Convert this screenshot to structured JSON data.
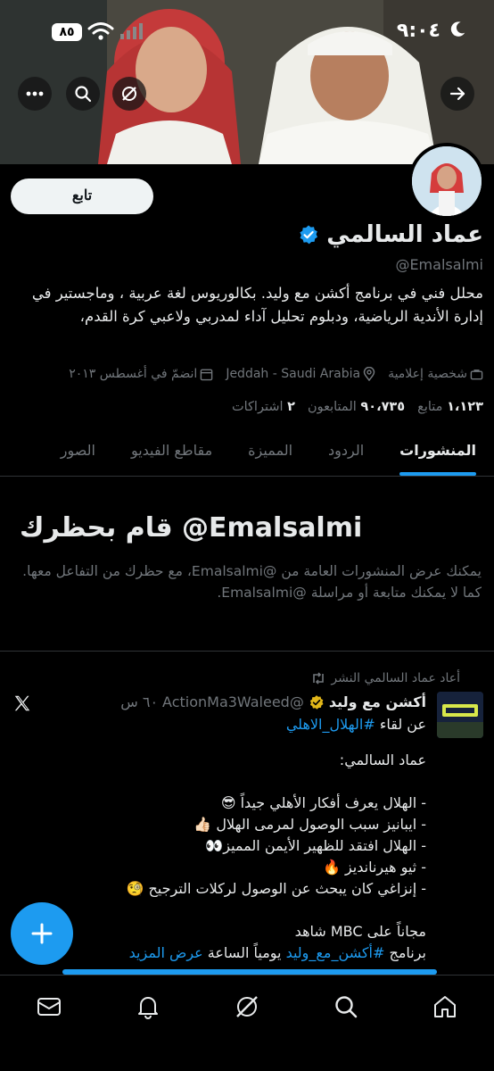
{
  "status_bar": {
    "time": "٩:٠٤",
    "battery": "٨٥"
  },
  "profile": {
    "follow_label": "تابع",
    "name": "عماد السالمي",
    "handle": "@Emalsalmi",
    "bio": "محلل فني في برنامج أكشن مع وليد. بكالوريوس لغة عربية ، وماجستير في إدارة الأندية الرياضية، ودبلوم تحليل آداء لمدربي ولاعبي كرة القدم،",
    "category": "شخصية إعلامية",
    "location": "Jeddah - Saudi Arabia",
    "joined": "انضمّ في أغسطس ٢٠١٣",
    "following_count": "١،١٢٣",
    "following_label": "متابع",
    "followers_count": "٩٠،٧٣٥",
    "followers_label": "المتابعون",
    "subscriptions_count": "٢",
    "subscriptions_label": "اشتراكات"
  },
  "tabs": [
    "المنشورات",
    "الردود",
    "المميزة",
    "مقاطع الفيديو",
    "الصور"
  ],
  "blocked": {
    "title": "قام بحظرك @Emalsalmi",
    "body": "يمكنك عرض المنشورات العامة من @Emalsalmi، مع حظرك من التفاعل معها. كما لا يمكنك متابعة أو مراسلة @Emalsalmi."
  },
  "post": {
    "retweet_label": "أعاد عماد السالمي النشر",
    "author": "أكشن مع وليد",
    "author_handle": "@ActionMa3Waleed",
    "time": "٦٠ س",
    "line1_prefix": "عن لقاء ",
    "line1_link": "#الهلال_الاهلي",
    "body": "عماد السالمي:\n\n- الهلال يعرف أفكار الأهلي جيداً 😎\n- ايبانيز سبب الوصول لمرمى الهلال 👍🏻\n- الهلال افتقد للظهير الأيمن المميز👀\n- ثيو هيرنانديز 🔥\n- إنزاغي كان يبحث عن الوصول لركلات الترجيح 🧐\n\nمجاناً على MBC شاهد",
    "last_prefix": "برنامج ",
    "last_link": "#أكشن_مع_وليد",
    "last_mid": " يومياً الساعة ",
    "show_more": "عرض المزيد"
  },
  "colors": {
    "accent": "#1d9bf0",
    "muted": "#71767b",
    "text": "#e7e9ea",
    "verified_gold": "#e2b719"
  }
}
